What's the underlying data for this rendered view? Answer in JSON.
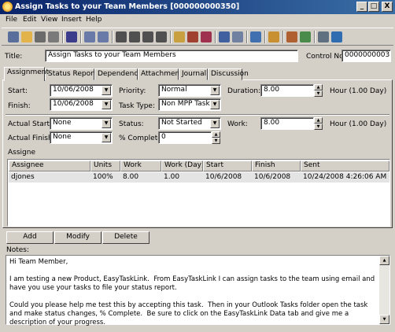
{
  "window": {
    "title": "Assign Tasks to your Team Members [000000000350]",
    "minimize": "_",
    "maximize": "□",
    "close": "X"
  },
  "menu": [
    "File",
    "Edit",
    "View",
    "Insert",
    "Help"
  ],
  "toolbar": {
    "icons": [
      "save-icon",
      "open-icon",
      "print-icon",
      "attach-icon",
      "undo-icon",
      "move-prev-icon",
      "move-next-icon",
      "first-icon",
      "back-icon",
      "stop-icon",
      "refresh-icon",
      "pencil-icon",
      "calendar-icon",
      "chart-icon",
      "mail-icon",
      "envelope-icon",
      "grid-icon",
      "note-icon",
      "tools-icon",
      "globe-icon",
      "folder-icon",
      "excel-icon"
    ],
    "colors": [
      "#5a6e9c",
      "#e2b34a",
      "#6b6b6b",
      "#7a7a7a",
      "#3c3c8c",
      "#6a7aa8",
      "#6a7aa8",
      "#505050",
      "#505050",
      "#505050",
      "#505050",
      "#c8a040",
      "#a04030",
      "#a03050",
      "#4060a0",
      "#7080a0",
      "#4070b0",
      "#c89030",
      "#b06030",
      "#4a8a4a",
      "#607080",
      "#2f6db0"
    ]
  },
  "form": {
    "title_label": "Title:",
    "title_value": "Assign Tasks to your Team Members",
    "control_label": "Control No.:",
    "control_value": "000000000350"
  },
  "tabs": [
    "Assignment",
    "Status Reports",
    "Dependency",
    "Attachment",
    "Journal",
    "Discussion"
  ],
  "assignment": {
    "start_label": "Start:",
    "start_value": "10/06/2008",
    "finish_label": "Finish:",
    "finish_value": "10/06/2008",
    "priority_label": "Priority:",
    "priority_value": "Normal",
    "task_type_label": "Task Type:",
    "task_type_value": "Non MPP Task",
    "duration_label": "Duration:",
    "duration_value": "8.00",
    "duration_unit": "Hour (1.00 Day)",
    "actual_start_label": "Actual Start:",
    "actual_start_value": "None",
    "actual_finish_label": "Actual Finish:",
    "actual_finish_value": "None",
    "status_label": "Status:",
    "status_value": "Not Started",
    "pct_label": "% Complete:",
    "pct_value": "0",
    "work_label": "Work:",
    "work_value": "8.00",
    "work_unit": "Hour (1.00 Day)",
    "assignee_section": "Assigne"
  },
  "grid": {
    "columns": [
      "Assignee",
      "Units",
      "Work",
      "Work (Day)",
      "Start",
      "Finish",
      "Sent"
    ],
    "rows": [
      [
        "djones",
        "100%",
        "8.00",
        "1.00",
        "10/6/2008",
        "10/6/2008",
        "10/24/2008 4:26:06 AM"
      ]
    ]
  },
  "buttons": {
    "add": "Add",
    "modify": "Modify",
    "delete": "Delete"
  },
  "notes": {
    "label": "Notes:",
    "text": "Hi Team Member,\n\nI am testing a new Product, EasyTaskLink.  From EasyTaskLink I can assign tasks to the team using email and have you use your tasks to file your status report.\n\nCould you please help me test this by accepting this task.  Then in your Outlook Tasks folder open the task and make status changes, % Complete.  Be sure to click on the EasyTaskLink Data tab and give me a description of your progress."
  }
}
